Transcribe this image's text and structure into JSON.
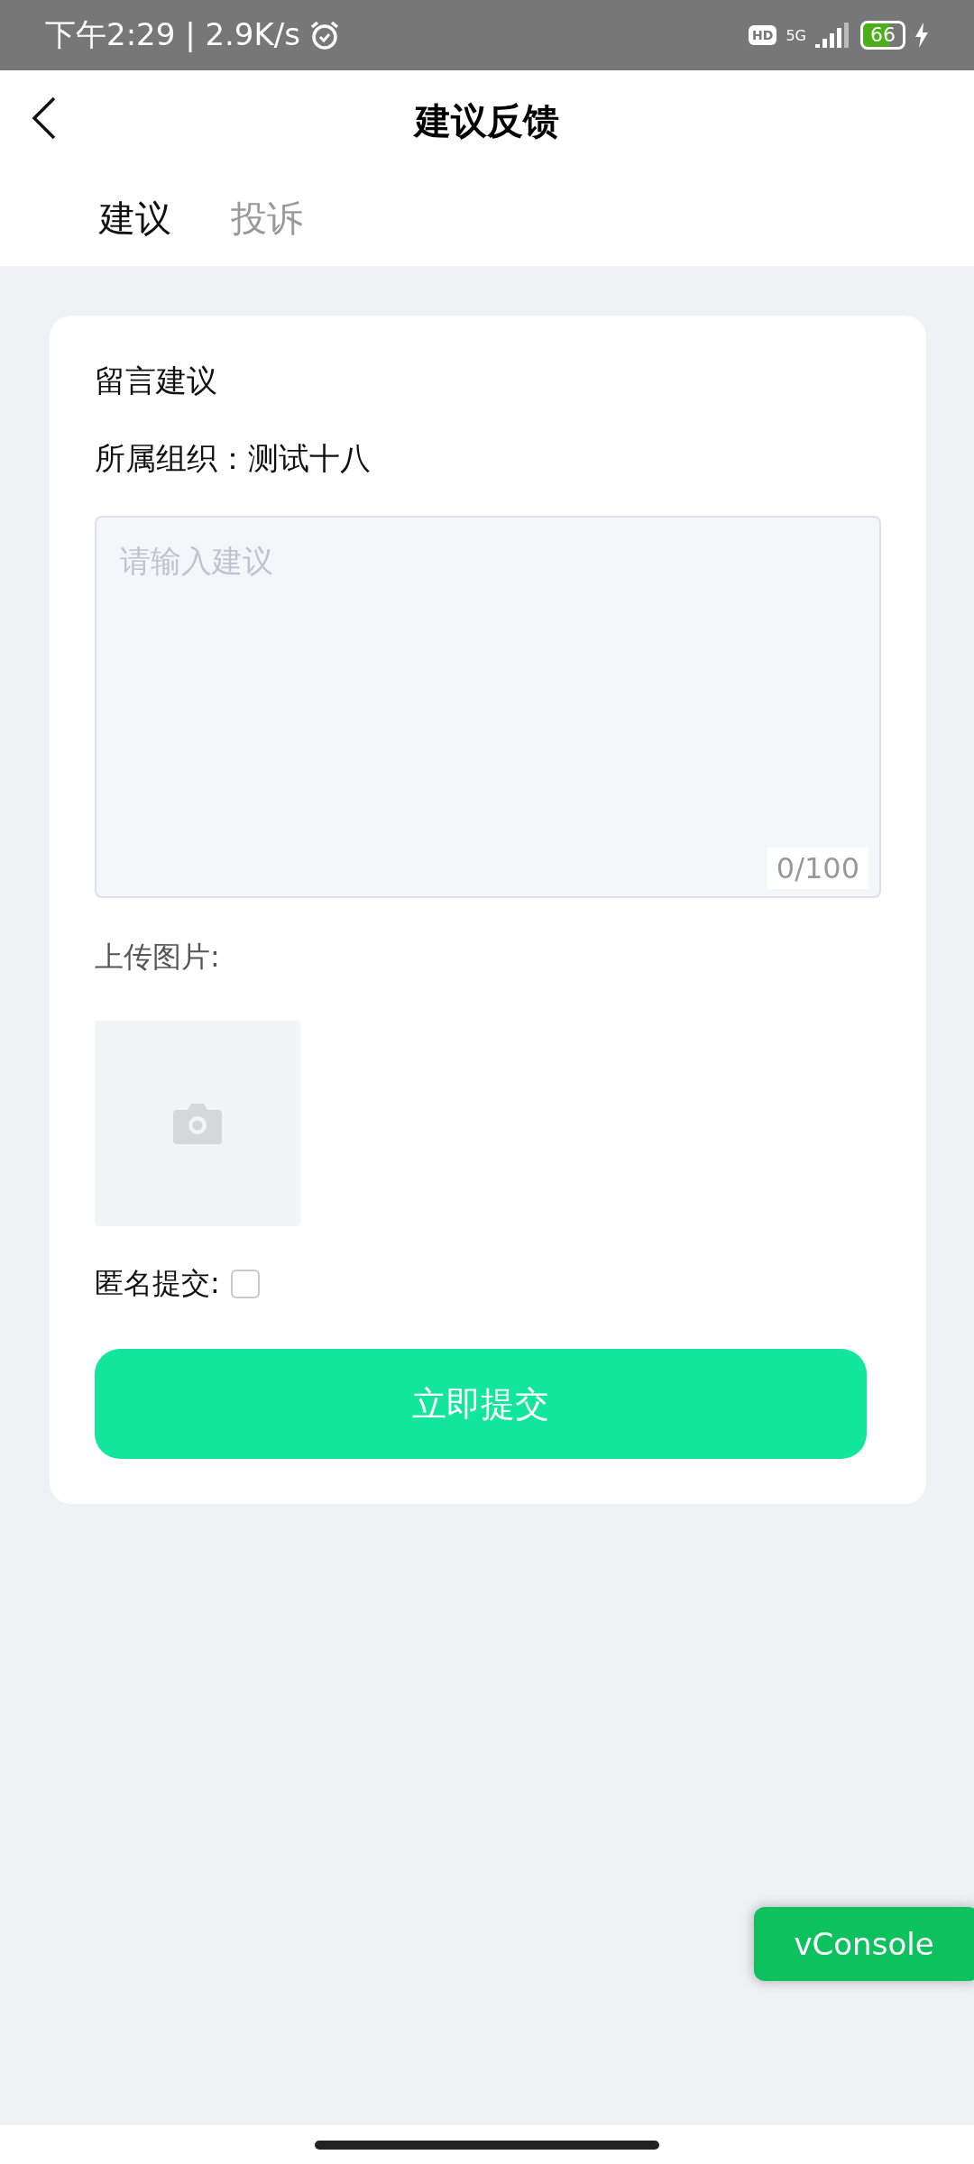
{
  "status_bar": {
    "time_speed": "下午2:29 | 2.9K/s",
    "hd": "HD",
    "network": "5G",
    "battery": "66"
  },
  "header": {
    "title": "建议反馈"
  },
  "tabs": [
    {
      "label": "建议",
      "selected": true
    },
    {
      "label": "投诉",
      "selected": false
    }
  ],
  "form": {
    "heading": "留言建议",
    "organization": "所属组织：测试十八",
    "suggestion": {
      "placeholder": "请输入建议",
      "counter": "0/100"
    },
    "upload_label": "上传图片:",
    "anonymous": {
      "label": "匿名提交:",
      "checked": false
    },
    "submit": "立即提交"
  },
  "debug_button": "vConsole"
}
